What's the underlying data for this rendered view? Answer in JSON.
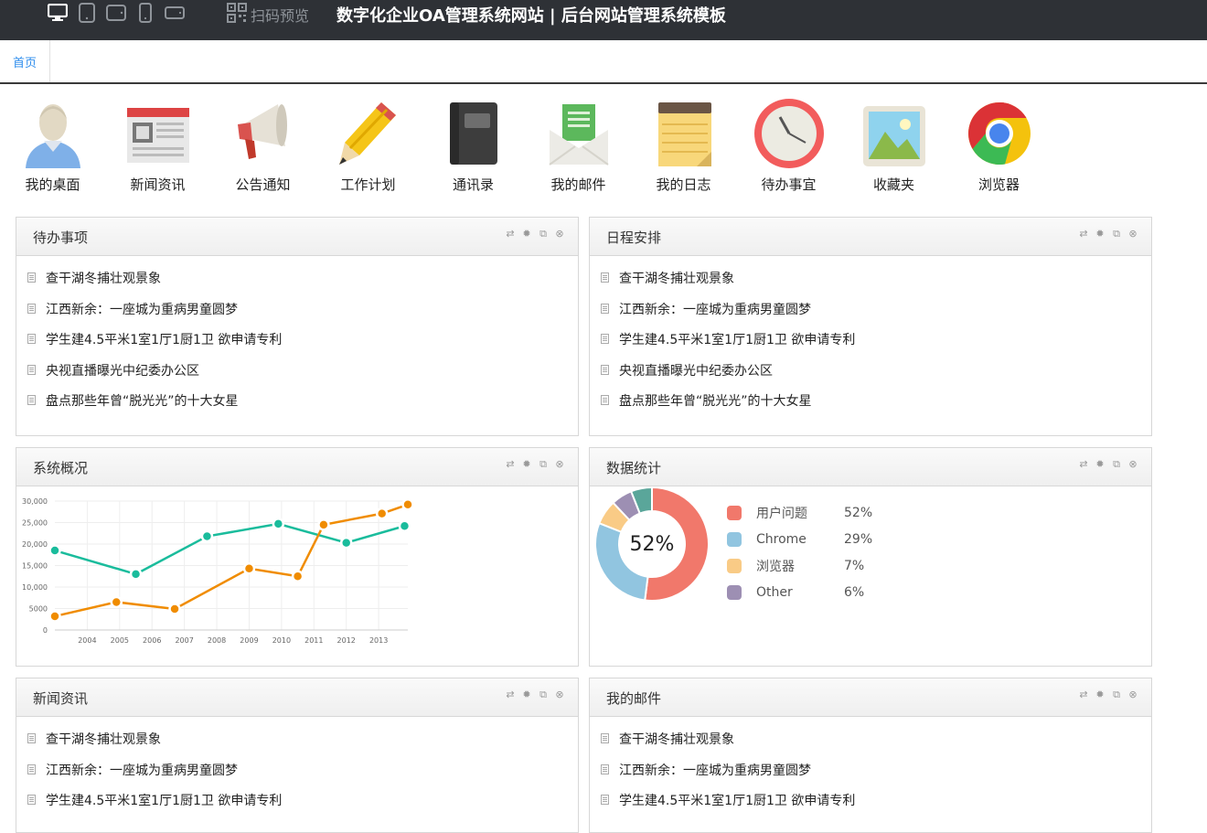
{
  "topbar": {
    "device_icons": [
      "desktop-icon",
      "tablet-icon",
      "tablet-landscape-icon",
      "phone-icon",
      "phone-landscape-icon"
    ],
    "qr_label": "扫码预览",
    "title": "数字化企业OA管理系统网站 | 后台网站管理系统模板"
  },
  "tabs": {
    "home": "首页"
  },
  "apps": [
    {
      "label": "我的桌面",
      "icon": "user-desktop-icon"
    },
    {
      "label": "新闻资讯",
      "icon": "newspaper-icon"
    },
    {
      "label": "公告通知",
      "icon": "megaphone-icon"
    },
    {
      "label": "工作计划",
      "icon": "pencil-icon"
    },
    {
      "label": "通讯录",
      "icon": "address-book-icon"
    },
    {
      "label": "我的邮件",
      "icon": "mail-icon"
    },
    {
      "label": "我的日志",
      "icon": "notepad-icon"
    },
    {
      "label": "待办事宜",
      "icon": "clock-icon"
    },
    {
      "label": "收藏夹",
      "icon": "picture-icon"
    },
    {
      "label": "浏览器",
      "icon": "chrome-icon"
    }
  ],
  "panels": {
    "todo": {
      "title": "待办事项",
      "items": [
        "查干湖冬捕壮观景象",
        "江西新余：一座城为重病男童圆梦",
        "学生建4.5平米1室1厅1厨1卫 欲申请专利",
        "央视直播曝光中纪委办公区",
        "盘点那些年曾“脱光光”的十大女星"
      ]
    },
    "schedule": {
      "title": "日程安排",
      "items": [
        "查干湖冬捕壮观景象",
        "江西新余：一座城为重病男童圆梦",
        "学生建4.5平米1室1厅1厨1卫 欲申请专利",
        "央视直播曝光中纪委办公区",
        "盘点那些年曾“脱光光”的十大女星"
      ]
    },
    "overview": {
      "title": "系统概况"
    },
    "stats": {
      "title": "数据统计",
      "center_label": "52%"
    },
    "news": {
      "title": "新闻资讯",
      "items": [
        "查干湖冬捕壮观景象",
        "江西新余：一座城为重病男童圆梦",
        "学生建4.5平米1室1厅1厨1卫 欲申请专利"
      ]
    },
    "mail": {
      "title": "我的邮件",
      "items": [
        "查干湖冬捕壮观景象",
        "江西新余：一座城为重病男童圆梦",
        "学生建4.5平米1室1厅1厨1卫 欲申请专利"
      ]
    }
  },
  "chart_data": [
    {
      "type": "line",
      "x_ticks": [
        "2004",
        "2005",
        "2006",
        "2007",
        "2008",
        "2009",
        "2010",
        "2011",
        "2012",
        "2013"
      ],
      "y_ticks": [
        "30,000",
        "25,000",
        "20,000",
        "15,000",
        "10,000",
        "5000",
        "0"
      ],
      "ylim": [
        0,
        30000
      ],
      "xlim": [
        2003,
        2013.9
      ],
      "grid": true,
      "series": [
        {
          "color": "#1abc9c",
          "x": [
            2003,
            2005.5,
            2007.7,
            2009.9,
            2012,
            2013.8
          ],
          "y": [
            18500,
            13000,
            21800,
            24700,
            20300,
            24200
          ]
        },
        {
          "color": "#f08c00",
          "x": [
            2003,
            2004.9,
            2006.7,
            2009,
            2010.5,
            2011.3,
            2013.1,
            2013.9
          ],
          "y": [
            3200,
            6500,
            4900,
            14300,
            12500,
            24500,
            27100,
            29200
          ]
        }
      ]
    },
    {
      "type": "pie",
      "labels": [
        "用户问题",
        "Chrome",
        "浏览器",
        "Other"
      ],
      "values": [
        52,
        29,
        7,
        6
      ],
      "value_labels": [
        "52%",
        "29%",
        "7%",
        "6%"
      ],
      "colors": [
        "#f1786b",
        "#91c5e0",
        "#f9cb86",
        "#9d8fb3"
      ]
    }
  ]
}
